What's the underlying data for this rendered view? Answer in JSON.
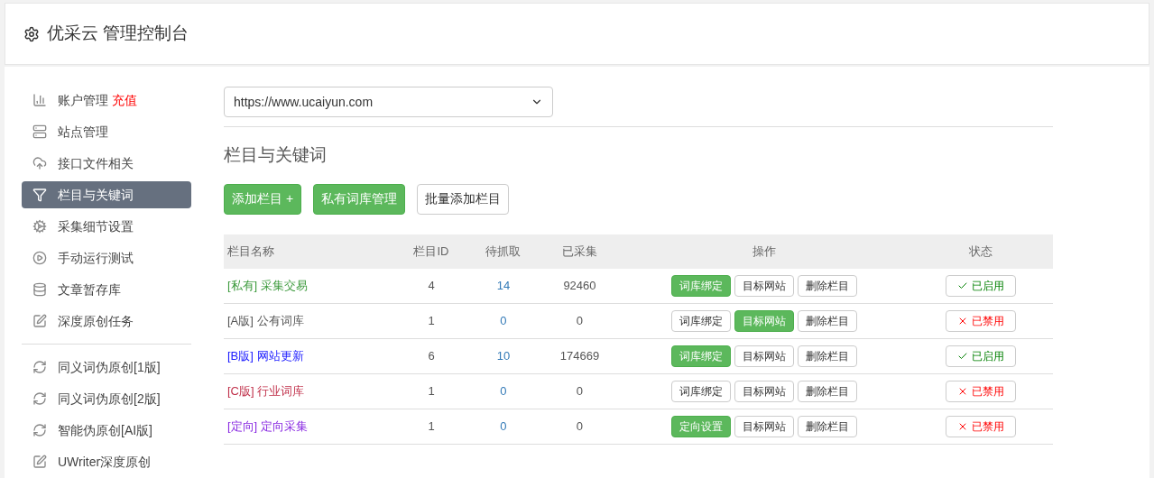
{
  "header": {
    "title": "优采云 管理控制台"
  },
  "sidebar": {
    "groups": [
      [
        {
          "label": "账户管理",
          "badge": "充值",
          "selected": false
        },
        {
          "label": "站点管理",
          "selected": false
        },
        {
          "label": "接口文件相关",
          "selected": false
        },
        {
          "label": "栏目与关键词",
          "selected": true
        },
        {
          "label": "采集细节设置",
          "selected": false
        },
        {
          "label": "手动运行测试",
          "selected": false
        },
        {
          "label": "文章暂存库",
          "selected": false
        },
        {
          "label": "深度原创任务",
          "selected": false
        }
      ],
      [
        {
          "label": "同义词伪原创[1版]",
          "selected": false
        },
        {
          "label": "同义词伪原创[2版]",
          "selected": false
        },
        {
          "label": "智能伪原创[AI版]",
          "selected": false
        },
        {
          "label": "UWriter深度原创",
          "selected": false
        }
      ]
    ]
  },
  "site_select": {
    "value": "https://www.ucaiyun.com"
  },
  "section": {
    "title": "栏目与关键词",
    "buttons": [
      {
        "label": "添加栏目 +",
        "primary": true
      },
      {
        "label": "私有词库管理",
        "primary": true
      },
      {
        "label": "批量添加栏目",
        "primary": false
      }
    ]
  },
  "table": {
    "columns": [
      "栏目名称",
      "栏目ID",
      "待抓取",
      "已采集",
      "操作",
      "状态"
    ],
    "rows": [
      {
        "tag": "[私有]",
        "name": "采集交易",
        "color": "#3c9a3c",
        "id": "4",
        "pending": "14",
        "collected": "92460",
        "actions": [
          {
            "label": "词库绑定",
            "primary": true
          },
          {
            "label": "目标网站",
            "primary": false
          },
          {
            "label": "删除栏目",
            "primary": false
          }
        ],
        "status": "已启用",
        "enabled": true
      },
      {
        "tag": "[A版]",
        "name": "公有词库",
        "color": "#555555",
        "id": "1",
        "pending": "0",
        "collected": "0",
        "actions": [
          {
            "label": "词库绑定",
            "primary": false
          },
          {
            "label": "目标网站",
            "primary": true
          },
          {
            "label": "删除栏目",
            "primary": false
          }
        ],
        "status": "已禁用",
        "enabled": false
      },
      {
        "tag": "[B版]",
        "name": "网站更新",
        "color": "#1a1aff",
        "id": "6",
        "pending": "10",
        "collected": "174669",
        "actions": [
          {
            "label": "词库绑定",
            "primary": true
          },
          {
            "label": "目标网站",
            "primary": false
          },
          {
            "label": "删除栏目",
            "primary": false
          }
        ],
        "status": "已启用",
        "enabled": true
      },
      {
        "tag": "[C版]",
        "name": "行业词库",
        "color": "#c0304a",
        "id": "1",
        "pending": "0",
        "collected": "0",
        "actions": [
          {
            "label": "词库绑定",
            "primary": false
          },
          {
            "label": "目标网站",
            "primary": false
          },
          {
            "label": "删除栏目",
            "primary": false
          }
        ],
        "status": "已禁用",
        "enabled": false
      },
      {
        "tag": "[定向]",
        "name": "定向采集",
        "color": "#8a2be2",
        "id": "1",
        "pending": "0",
        "collected": "0",
        "actions": [
          {
            "label": "定向设置",
            "primary": true
          },
          {
            "label": "目标网站",
            "primary": false
          },
          {
            "label": "删除栏目",
            "primary": false
          }
        ],
        "status": "已禁用",
        "enabled": false
      }
    ]
  }
}
